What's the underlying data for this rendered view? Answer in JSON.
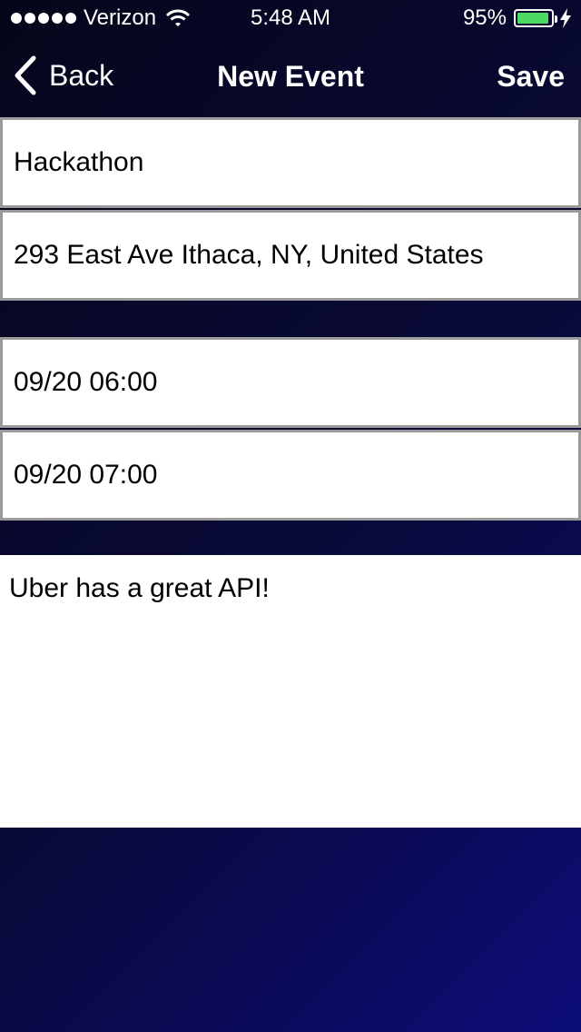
{
  "status_bar": {
    "carrier": "Verizon",
    "time": "5:48 AM",
    "battery": "95%",
    "battery_level": 0.95,
    "battery_color": "#4cd964"
  },
  "nav": {
    "back_label": "Back",
    "title": "New Event",
    "save_label": "Save"
  },
  "form": {
    "title": "Hackathon",
    "location": "293 East Ave Ithaca, NY, United States",
    "start": "09/20 06:00",
    "end": "09/20 07:00",
    "notes": "Uber has a great API!"
  },
  "icons": [
    "signal-icon",
    "wifi-icon",
    "battery-icon",
    "charging-bolt-icon",
    "chevron-left-icon"
  ]
}
